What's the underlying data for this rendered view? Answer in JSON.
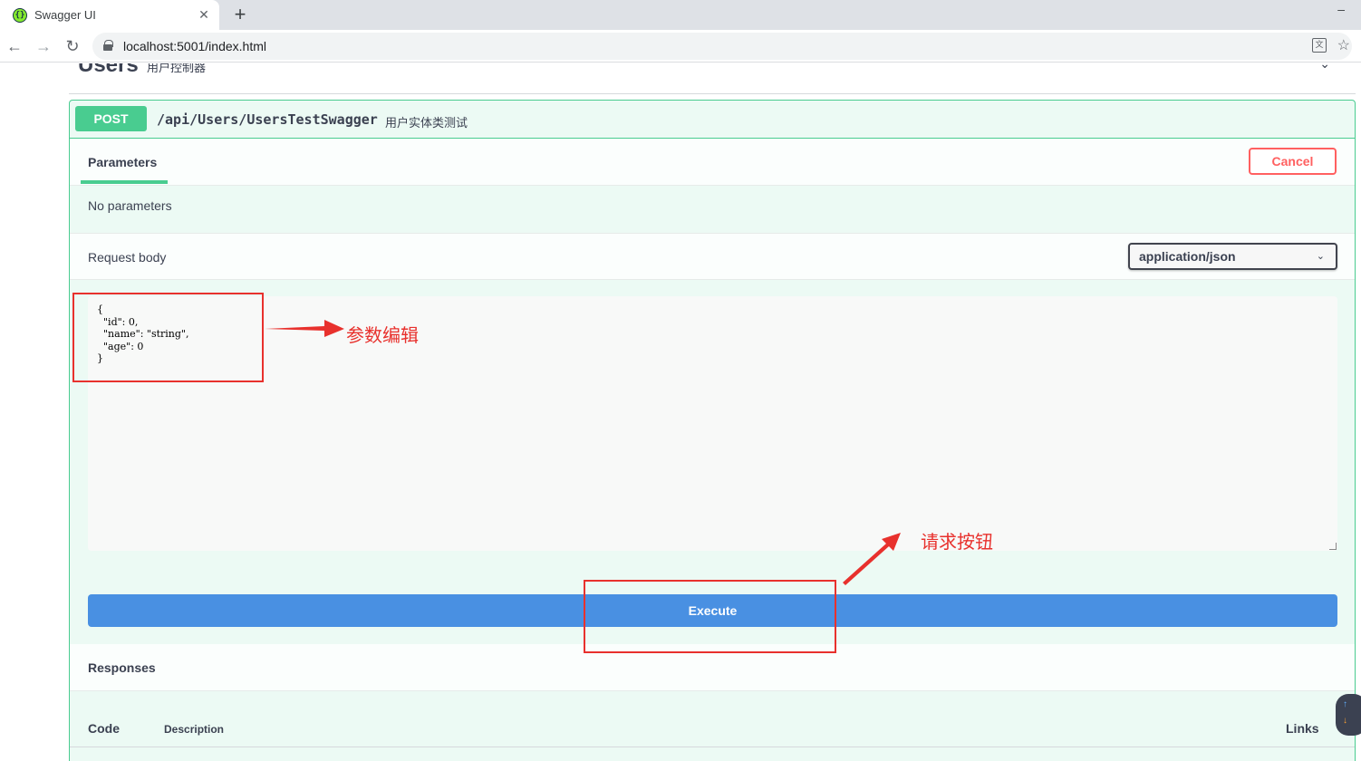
{
  "browser": {
    "tab_title": "Swagger UI",
    "favicon_glyph": "{}",
    "close_glyph": "✕",
    "newtab_glyph": "+",
    "minimize_glyph": "–",
    "back_glyph": "←",
    "forward_glyph": "→",
    "reload_glyph": "↻",
    "url": "localhost:5001/index.html",
    "translate_glyph": "文",
    "star_glyph": "☆"
  },
  "section": {
    "name": "Users",
    "description": "用户控制器",
    "chevron_glyph": "⌄"
  },
  "operation": {
    "method": "POST",
    "path": "/api/Users/UsersTestSwagger",
    "summary": "用户实体类测试",
    "parameters_tab": "Parameters",
    "cancel_label": "Cancel",
    "no_parameters": "No parameters",
    "request_body_label": "Request body",
    "content_type": "application/json",
    "content_type_arrow": "⌄",
    "request_body": "{\n  \"id\": 0,\n  \"name\": \"string\",\n  \"age\": 0\n}",
    "execute_label": "Execute",
    "responses_title": "Responses",
    "columns": {
      "code": "Code",
      "description": "Description",
      "links": "Links"
    }
  },
  "scroll_widget": {
    "up_glyph": "↑",
    "down_glyph": "↓"
  },
  "annotations": {
    "param_edit": "参数编辑",
    "request_button": "请求按钮",
    "color": "#e8312d"
  },
  "colors": {
    "post": "#49cc90",
    "execute": "#4990e2",
    "cancel": "#ff6060"
  }
}
